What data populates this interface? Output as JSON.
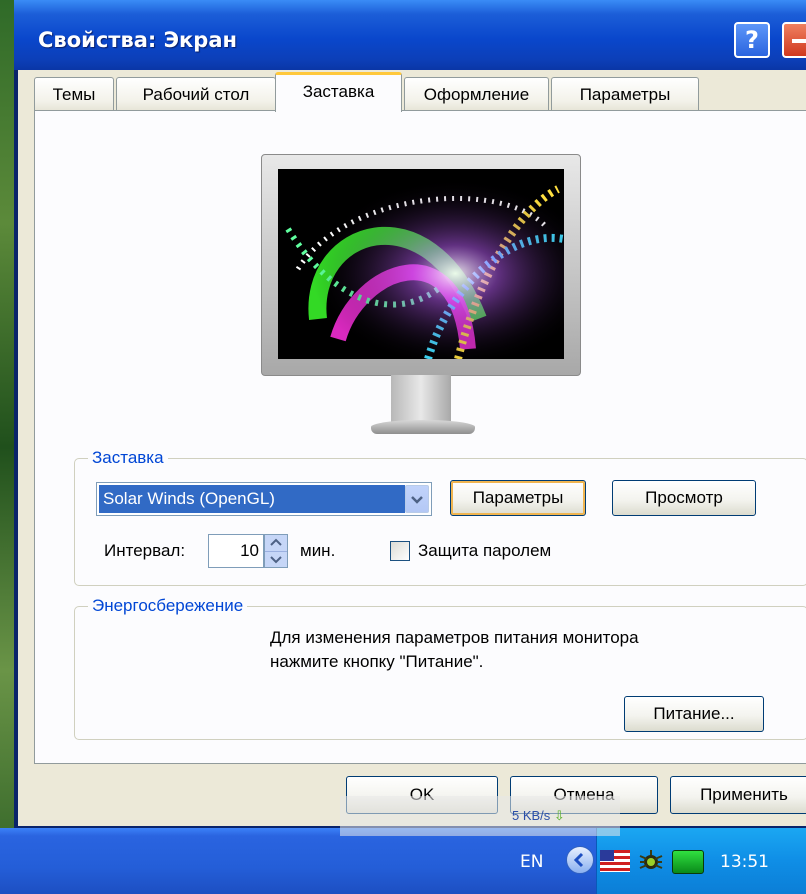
{
  "window": {
    "title": "Свойства: Экран",
    "help_label": "?"
  },
  "tabs": [
    {
      "label": "Темы",
      "active": false
    },
    {
      "label": "Рабочий стол",
      "active": false
    },
    {
      "label": "Заставка",
      "active": true
    },
    {
      "label": "Оформление",
      "active": false
    },
    {
      "label": "Параметры",
      "active": false
    }
  ],
  "screensaver": {
    "group_label": "Заставка",
    "selected": "Solar Winds (OpenGL)",
    "settings_button": "Параметры",
    "preview_button": "Просмотр",
    "interval_label": "Интервал:",
    "interval_value": "10",
    "interval_unit": "мин.",
    "password_label": "Защита паролем",
    "password_checked": false
  },
  "power": {
    "group_label": "Энергосбережение",
    "description_line1": "Для изменения параметров питания монитора",
    "description_line2": "нажмите кнопку \"Питание\".",
    "power_button": "Питание..."
  },
  "dialog_buttons": {
    "ok": "OK",
    "cancel": "Отмена",
    "apply": "Применить"
  },
  "network": {
    "speed": "5 KB/s"
  },
  "taskbar": {
    "language": "EN",
    "clock": "13:51"
  },
  "colors": {
    "accent": "#0a47cc",
    "tab_highlight": "#ffc83c",
    "group_label": "#0046d5",
    "selection": "#316ac5"
  }
}
